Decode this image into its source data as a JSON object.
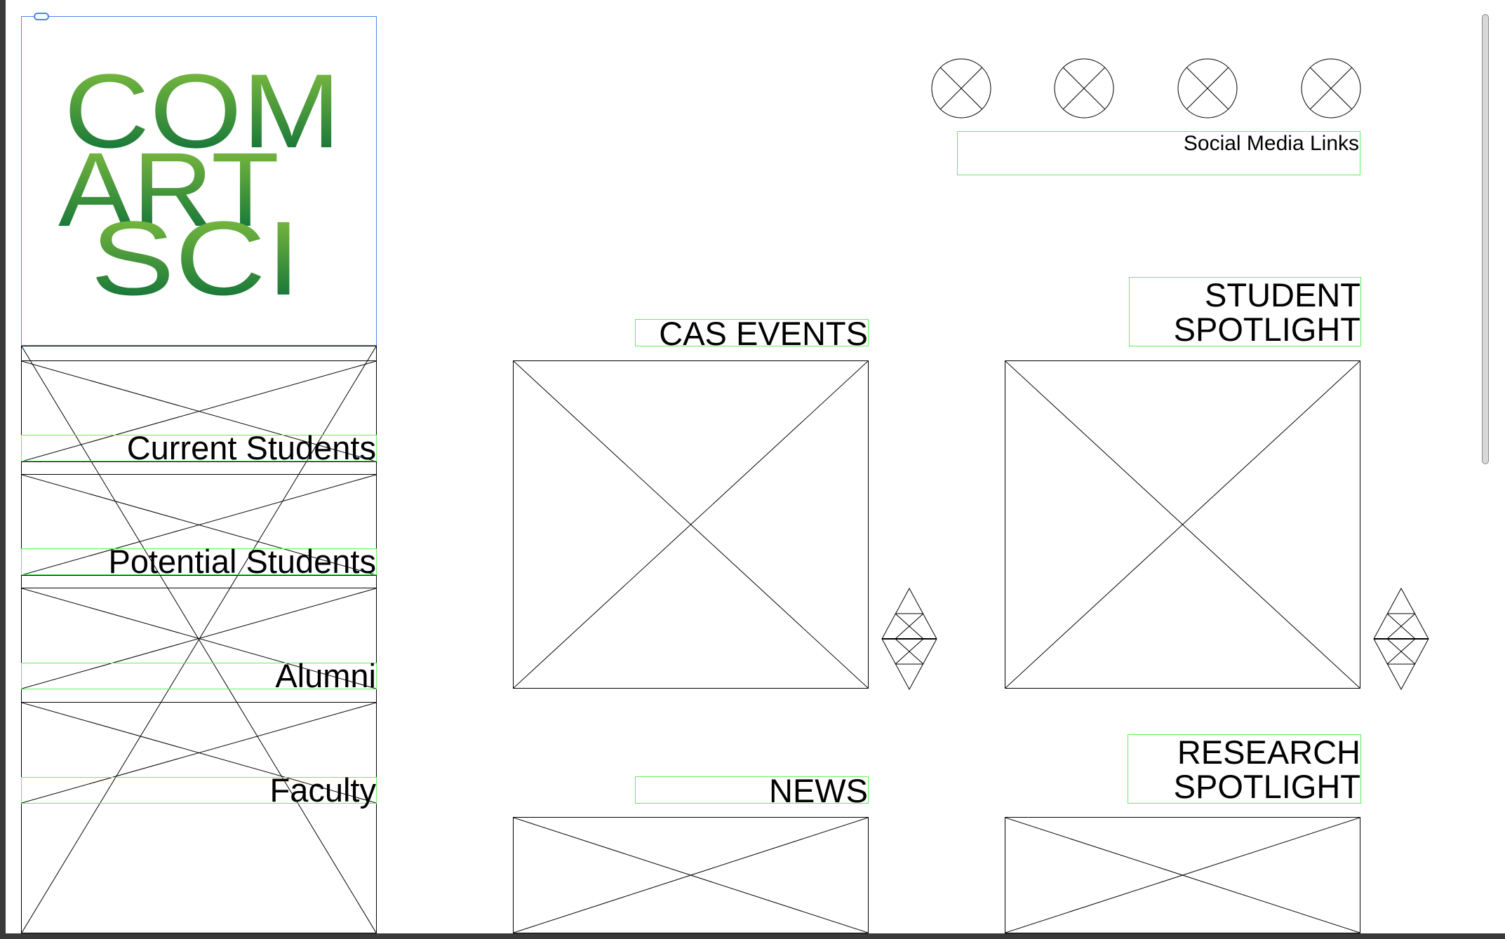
{
  "logo": {
    "lines": [
      "COM",
      "ART",
      "SCI"
    ],
    "alt_text": "COMARTSCI",
    "gradient_top": "#8dc63f",
    "gradient_bottom": "#006838"
  },
  "social": {
    "label": "Social Media Links",
    "icon_count": 4
  },
  "nav": {
    "items": [
      {
        "label": "Current Students"
      },
      {
        "label": "Potential Students"
      },
      {
        "label": "Alumni"
      },
      {
        "label": "Faculty"
      }
    ]
  },
  "sections": {
    "cas_events": "CAS EVENTS",
    "student_spotlight": [
      "STUDENT",
      "SPOTLIGHT"
    ],
    "news": "NEWS",
    "research_spotlight": [
      "RESEARCH",
      "SPOTLIGHT"
    ]
  },
  "colors": {
    "frame": "#000000",
    "text_frame": "#5cf25c",
    "selection": "#4a86e8",
    "window_border": "#3a3a3a"
  }
}
